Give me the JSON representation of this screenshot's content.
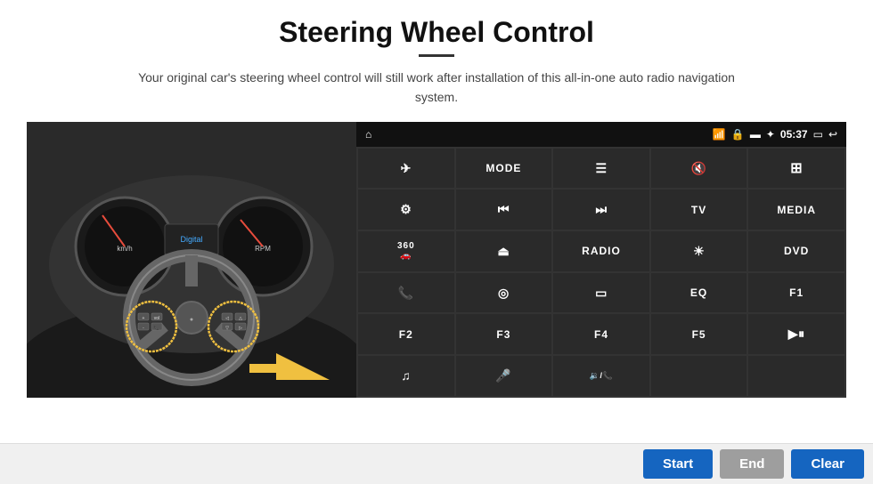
{
  "header": {
    "title": "Steering Wheel Control",
    "subtitle": "Your original car's steering wheel control will still work after installation of this all-in-one auto radio navigation system."
  },
  "status_bar": {
    "time": "05:37",
    "icons": [
      "home",
      "wifi",
      "lock",
      "sd",
      "bluetooth",
      "screen"
    ]
  },
  "grid_buttons": [
    {
      "id": "nav",
      "icon": "✈",
      "type": "icon"
    },
    {
      "id": "mode",
      "label": "MODE",
      "type": "text"
    },
    {
      "id": "list",
      "icon": "☰",
      "type": "icon"
    },
    {
      "id": "mute",
      "icon": "🔇",
      "type": "icon"
    },
    {
      "id": "apps",
      "icon": "⊞",
      "type": "icon"
    },
    {
      "id": "settings",
      "icon": "⚙",
      "type": "icon"
    },
    {
      "id": "prev",
      "icon": "⏮",
      "type": "icon"
    },
    {
      "id": "next",
      "icon": "⏭",
      "type": "icon"
    },
    {
      "id": "tv",
      "label": "TV",
      "type": "text"
    },
    {
      "id": "media",
      "label": "MEDIA",
      "type": "text"
    },
    {
      "id": "360",
      "icon": "360",
      "type": "text"
    },
    {
      "id": "eject",
      "icon": "⏏",
      "type": "icon"
    },
    {
      "id": "radio",
      "label": "RADIO",
      "type": "text"
    },
    {
      "id": "brightness",
      "icon": "☀",
      "type": "icon"
    },
    {
      "id": "dvd",
      "label": "DVD",
      "type": "text"
    },
    {
      "id": "phone",
      "icon": "📞",
      "type": "icon"
    },
    {
      "id": "browser",
      "icon": "◎",
      "type": "icon"
    },
    {
      "id": "screen",
      "icon": "▭",
      "type": "icon"
    },
    {
      "id": "eq",
      "label": "EQ",
      "type": "text"
    },
    {
      "id": "f1",
      "label": "F1",
      "type": "text"
    },
    {
      "id": "f2",
      "label": "F2",
      "type": "text"
    },
    {
      "id": "f3",
      "label": "F3",
      "type": "text"
    },
    {
      "id": "f4",
      "label": "F4",
      "type": "text"
    },
    {
      "id": "f5",
      "label": "F5",
      "type": "text"
    },
    {
      "id": "playpause",
      "icon": "▶⏸",
      "type": "icon"
    },
    {
      "id": "music",
      "icon": "♫",
      "type": "icon"
    },
    {
      "id": "mic",
      "icon": "🎤",
      "type": "icon"
    },
    {
      "id": "volphone",
      "icon": "🔉/📞",
      "type": "icon"
    },
    {
      "id": "empty1",
      "label": "",
      "type": "text"
    },
    {
      "id": "empty2",
      "label": "",
      "type": "text"
    }
  ],
  "bottom_bar": {
    "start_label": "Start",
    "end_label": "End",
    "clear_label": "Clear"
  }
}
